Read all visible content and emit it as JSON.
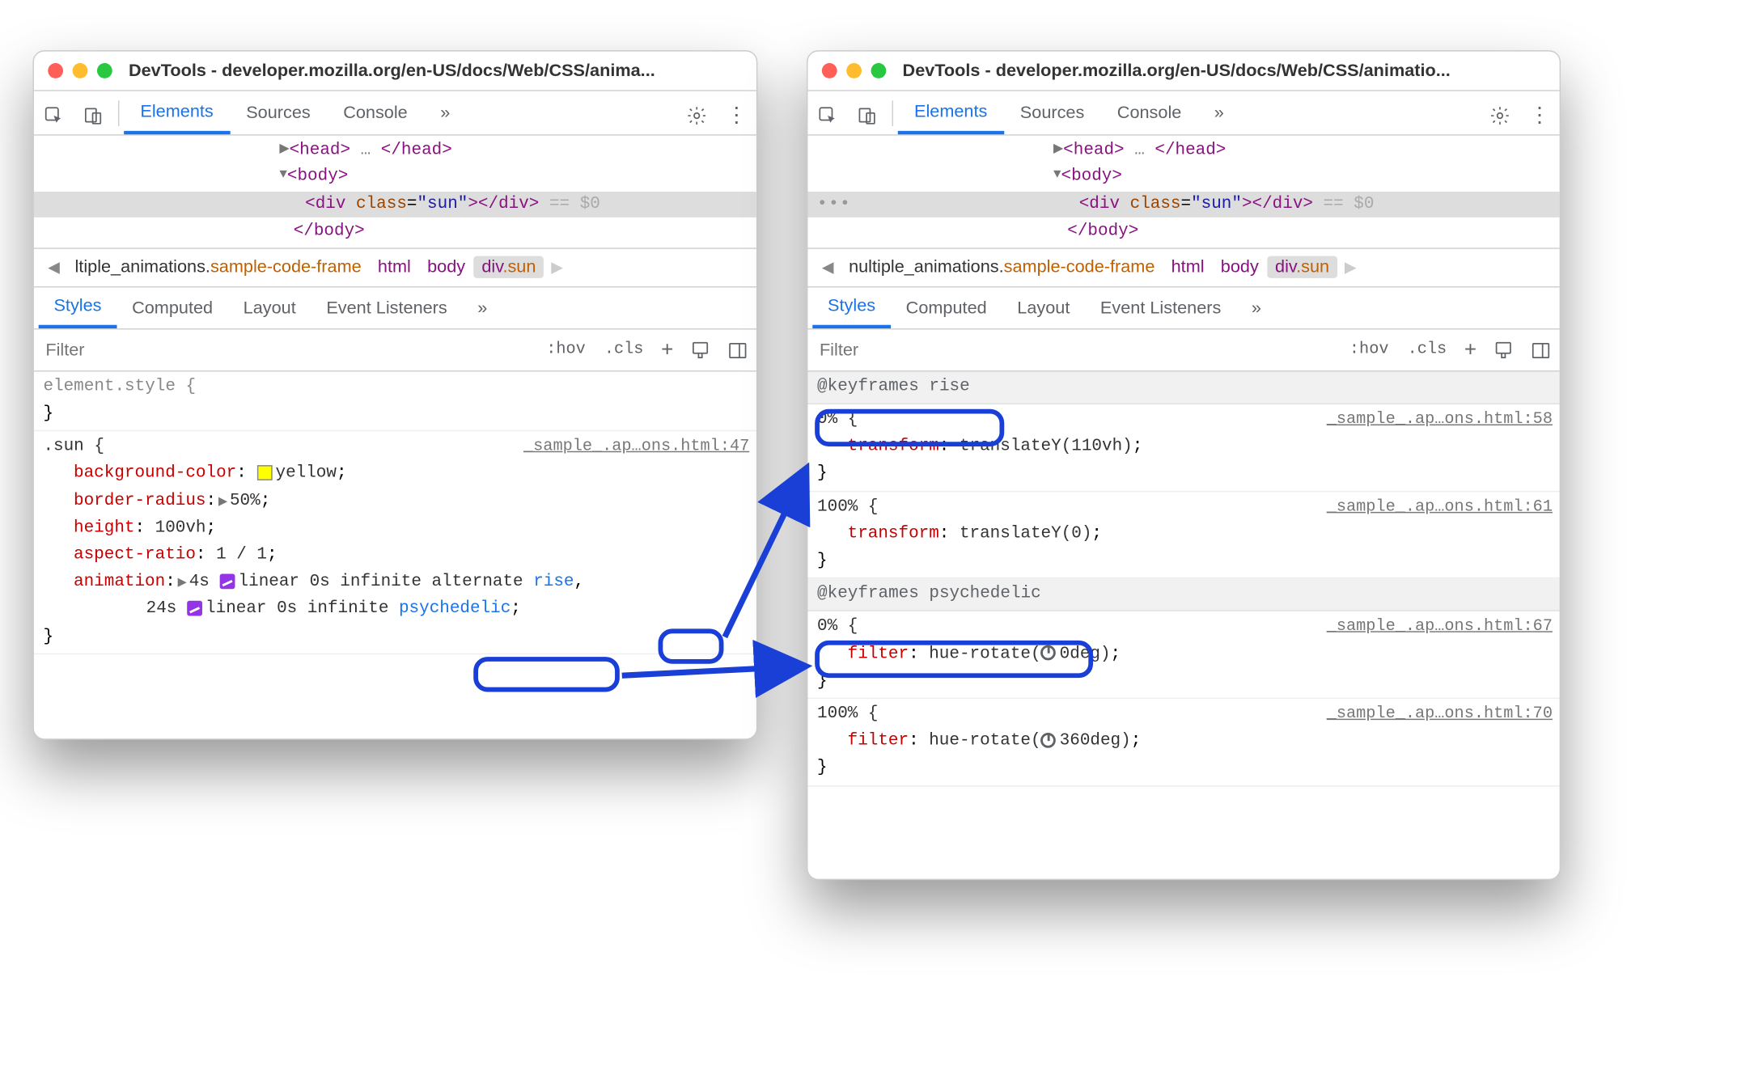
{
  "left": {
    "title": "DevTools - developer.mozilla.org/en-US/docs/Web/CSS/anima...",
    "tabs": {
      "elements": "Elements",
      "sources": "Sources",
      "console": "Console",
      "more": "»"
    },
    "dom": {
      "head_open": "<head>",
      "head_dots": "…",
      "head_close": "</head>",
      "body_open": "<body>",
      "div_open": "<div",
      "class_attr": "class",
      "class_val": "\"sun\"",
      "div_close": "></div>",
      "eq": "== $0",
      "body_close": "</body>"
    },
    "breadcrumb": {
      "seg1a": "ltiple_animations.",
      "seg1b": "sample-code-frame",
      "seg2": "html",
      "seg3": "body",
      "seg4": "div",
      "seg4b": ".sun"
    },
    "panel_tabs": {
      "styles": "Styles",
      "computed": "Computed",
      "layout": "Layout",
      "events": "Event Listeners",
      "more": "»"
    },
    "filter": {
      "placeholder": "Filter",
      "hov": ":hov",
      "cls": ".cls"
    },
    "rule_elstyle_sel": "element.style {",
    "rule_elstyle_close": "}",
    "rule_sun": {
      "sel": ".sun {",
      "src": "_sample_.ap…ons.html:47",
      "bg_prop": "background-color",
      "bg_val": "yellow",
      "br_prop": "border-radius",
      "br_val": "50%",
      "h_prop": "height",
      "h_val": "100vh",
      "ar_prop": "aspect-ratio",
      "ar_val": "1 / 1",
      "anim_prop": "animation",
      "anim_line1_a": "4s ",
      "anim_line1_ease": "linear",
      "anim_line1_b": " 0s infinite alternate ",
      "anim_name1": "rise",
      "anim_line2_a": "24s ",
      "anim_line2_ease": "linear",
      "anim_line2_b": " 0s infinite ",
      "anim_name2": "psychedelic",
      "close": "}"
    }
  },
  "right": {
    "title": "DevTools - developer.mozilla.org/en-US/docs/Web/CSS/animatio...",
    "tabs": {
      "elements": "Elements",
      "sources": "Sources",
      "console": "Console",
      "more": "»"
    },
    "dom": {
      "head_open": "<head>",
      "head_dots": "…",
      "head_close": "</head>",
      "body_open": "<body>",
      "div_open": "<div",
      "class_attr": "class",
      "class_val": "\"sun\"",
      "div_close": "></div>",
      "eq": "== $0",
      "body_close": "</body>"
    },
    "breadcrumb": {
      "seg1a": "nultiple_animations.",
      "seg1b": "sample-code-frame",
      "seg2": "html",
      "seg3": "body",
      "seg4": "div",
      "seg4b": ".sun"
    },
    "panel_tabs": {
      "styles": "Styles",
      "computed": "Computed",
      "layout": "Layout",
      "events": "Event Listeners",
      "more": "»"
    },
    "filter": {
      "placeholder": "Filter",
      "hov": ":hov",
      "cls": ".cls"
    },
    "kf1": {
      "header": "@keyframes rise",
      "r1_sel": "0% {",
      "r1_src": "_sample_.ap…ons.html:58",
      "r1_prop": "transform",
      "r1_val": "translateY(110vh)",
      "r2_sel": "100% {",
      "r2_src": "_sample_.ap…ons.html:61",
      "r2_prop": "transform",
      "r2_val": "translateY(0)",
      "close": "}"
    },
    "kf2": {
      "header": "@keyframes psychedelic",
      "r1_sel": "0% {",
      "r1_src": "_sample_.ap…ons.html:67",
      "r1_prop": "filter",
      "r1_val_a": "hue-rotate(",
      "r1_val_b": "0deg)",
      "r2_sel": "100% {",
      "r2_src": "_sample_.ap…ons.html:70",
      "r2_prop": "filter",
      "r2_val_a": "hue-rotate(",
      "r2_val_b": "360deg)",
      "close": "}"
    }
  }
}
